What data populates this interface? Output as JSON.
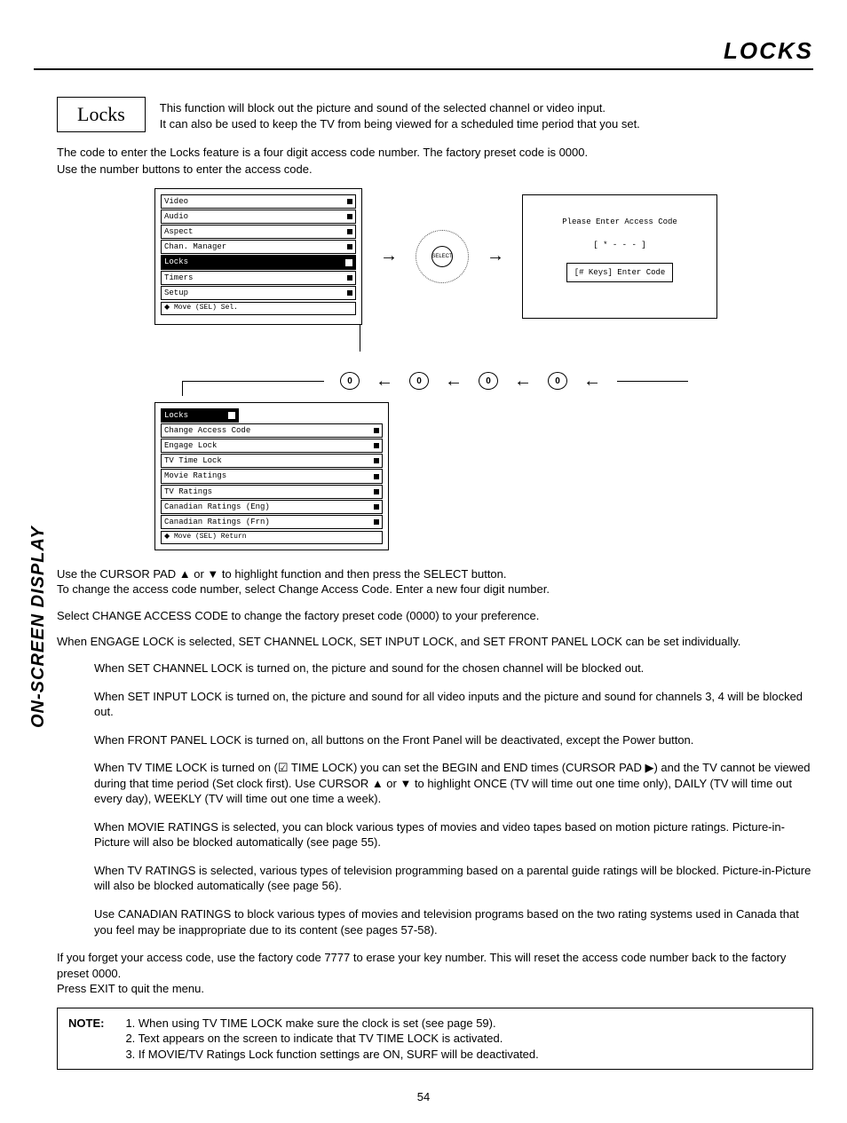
{
  "header": {
    "title": "LOCKS"
  },
  "sideTab": "ON-SCREEN DISPLAY",
  "section": {
    "box": "Locks",
    "intro1": "This function will block out the picture and sound of the selected channel or video input.",
    "intro2": "It can also be used to keep the TV from being viewed for a scheduled time period that you set."
  },
  "para1": "The code to enter the Locks feature is a four digit access code number.  The factory preset code is 0000.",
  "para2": "Use the number buttons to enter the access code.",
  "osd1": {
    "items": [
      "Video",
      "Audio",
      "Aspect",
      "Chan. Manager",
      "Locks",
      "Timers",
      "Setup"
    ],
    "selectedIndex": 4,
    "hint": "◆ Move  (SEL) Sel."
  },
  "remoteLabel": "SELECT",
  "osd3": {
    "title": "Please Enter Access Code",
    "code": "[ * - - - ]",
    "hint": "[# Keys] Enter Code"
  },
  "digits": [
    "0",
    "0",
    "0",
    "0"
  ],
  "osd2": {
    "title": "Locks",
    "items": [
      "Change Access Code",
      "Engage Lock",
      "TV Time Lock",
      "Movie Ratings",
      "TV Ratings",
      "Canadian Ratings (Eng)",
      "Canadian Ratings (Frn)"
    ],
    "hint": "◆ Move (SEL) Return"
  },
  "body": {
    "p1a": "Use the CURSOR PAD ▲ or ▼ to highlight function and then press the SELECT button.",
    "p1b": "To change the access code number, select Change Access Code.  Enter a new four digit number.",
    "p2": "Select CHANGE ACCESS CODE to change the factory preset code (0000) to your preference.",
    "p3": "When ENGAGE LOCK is selected, SET CHANNEL LOCK, SET INPUT LOCK, and SET FRONT PANEL LOCK can be set individually.",
    "p4": "When SET CHANNEL LOCK is turned on, the picture and sound for the chosen channel will be blocked out.",
    "p5": "When SET INPUT LOCK is turned on, the picture and sound for all video inputs and the picture and sound for channels 3, 4 will be blocked out.",
    "p6": "When FRONT PANEL LOCK is turned on, all buttons on the Front Panel will be deactivated, except the Power button.",
    "p7": "When TV TIME LOCK is turned on (☑ TIME LOCK) you can set the BEGIN and END times (CURSOR PAD ▶) and the TV cannot be viewed during that time period (Set clock first). Use CURSOR ▲ or ▼ to highlight ONCE (TV will time out one time only), DAILY (TV will time out every day), WEEKLY (TV will time out one time a week).",
    "p8": "When MOVIE RATINGS is selected, you can block various types of movies and video tapes based on motion picture ratings.  Picture-in-Picture will also be blocked automatically (see page 55).",
    "p9": "When TV RATINGS is selected, various types of television programming based on a parental guide ratings will be blocked.  Picture-in-Picture will also be blocked automatically (see page 56).",
    "p10": "Use CANADIAN RATINGS to block various types of movies and television programs based on the two rating systems used in Canada that you feel may be inappropriate due to its content (see pages 57-58).",
    "p11": "If you forget your access code, use the factory code 7777 to erase your key number. This will reset the access code number back to the factory preset 0000.",
    "p12": "Press EXIT to quit the menu."
  },
  "note": {
    "label": "NOTE:",
    "n1": "1. When using TV TIME LOCK make sure the clock is set (see page 59).",
    "n2": "2. Text appears on the screen to indicate that TV TIME LOCK is activated.",
    "n3": "3. If MOVIE/TV Ratings Lock function settings are ON, SURF will be deactivated."
  },
  "pageNum": "54"
}
